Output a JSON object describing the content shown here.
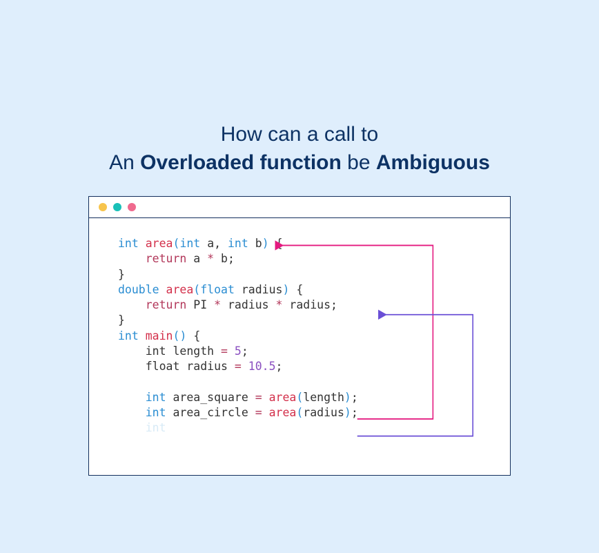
{
  "title": {
    "line1": "How can a call to",
    "line2_prefix": "An ",
    "line2_bold1": "Overloaded function",
    "line2_mid": " be ",
    "line2_bold2": "Ambiguous"
  },
  "code": {
    "l1": {
      "t_int": "int",
      "sp1": " ",
      "fn": "area",
      "po": "(",
      "a_t": "int",
      "sp2": " ",
      "a": "a",
      "c": ", ",
      "b_t": "int",
      "sp3": " ",
      "b": "b",
      "pc": ")",
      "sp4": " ",
      "ob": "{"
    },
    "l2": {
      "indent": "    ",
      "ret": "return",
      "sp": " ",
      "a": "a",
      "sp2": " ",
      "op": "*",
      "sp3": " ",
      "b": "b",
      "semi": ";"
    },
    "l3": {
      "cb": "}"
    },
    "l4": {
      "t_dbl": "double",
      "sp1": " ",
      "fn": "area",
      "po": "(",
      "p_t": "float",
      "sp2": " ",
      "p": "radius",
      "pc": ")",
      "sp3": " ",
      "ob": "{"
    },
    "l5": {
      "indent": "    ",
      "ret": "return",
      "sp": " ",
      "pi": "PI",
      "sp2": " ",
      "op1": "*",
      "sp3": " ",
      "r1": "radius",
      "sp4": " ",
      "op2": "*",
      "sp5": " ",
      "r2": "radius",
      "semi": ";"
    },
    "l6": {
      "cb": "}"
    },
    "l7": {
      "t_int": "int",
      "sp1": " ",
      "fn": "main",
      "po": "(",
      "pc": ")",
      "sp2": " ",
      "ob": "{"
    },
    "l8": {
      "indent": "    ",
      "t": "int",
      "sp": " ",
      "v": "length",
      "sp2": " ",
      "eq": "=",
      "sp3": " ",
      "n": "5",
      "semi": ";"
    },
    "l9": {
      "indent": "    ",
      "t": "float",
      "sp": " ",
      "v": "radius",
      "sp2": " ",
      "eq": "=",
      "sp3": " ",
      "n": "10.5",
      "semi": ";"
    },
    "blank": "",
    "l11": {
      "indent": "    ",
      "t": "int",
      "sp": " ",
      "v": "area_square",
      "sp2": " ",
      "eq": "=",
      "sp3": " ",
      "fn": "area",
      "po": "(",
      "arg": "length",
      "pc": ")",
      "semi": ";"
    },
    "l12": {
      "indent": "    ",
      "t": "int",
      "sp": " ",
      "v": "area_circle",
      "sp2": " ",
      "eq": "=",
      "sp3": " ",
      "fn": "area",
      "po": "(",
      "arg": "radius",
      "pc": ")",
      "semi": ";"
    }
  },
  "arrows": {
    "pink": {
      "from_call_line": 11,
      "to_def_line": 1,
      "color": "#e4197f"
    },
    "purple": {
      "from_call_line": 12,
      "to_def_line": 5,
      "color": "#6a4fd6"
    }
  },
  "faded_last": "int"
}
